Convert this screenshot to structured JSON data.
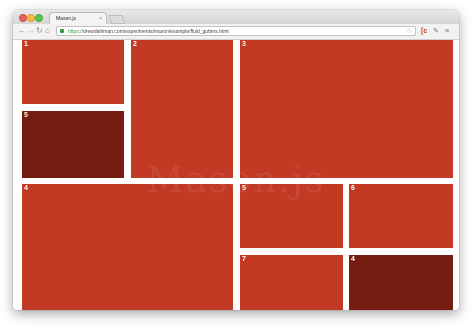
{
  "browser": {
    "tab_title": "Mason.js",
    "tab_close": "×",
    "url_https": "https://",
    "url_rest": "drewdahlman.com/experiments/mason/example/fluid_gutters.html",
    "icons": {
      "back": "←",
      "forward": "→",
      "reload": "↻",
      "home": "⌂",
      "star": "☆",
      "ext1": "[c",
      "ext2": "✎",
      "menu": "≡"
    }
  },
  "page": {
    "watermark": "Mason.js"
  },
  "tiles": [
    {
      "label": "1",
      "shade": "normal"
    },
    {
      "label": "2",
      "shade": "normal"
    },
    {
      "label": "3",
      "shade": "normal"
    },
    {
      "label": "5",
      "shade": "dark"
    },
    {
      "label": "4",
      "shade": "normal"
    },
    {
      "label": "5",
      "shade": "normal"
    },
    {
      "label": "6",
      "shade": "normal"
    },
    {
      "label": "7",
      "shade": "normal"
    },
    {
      "label": "4",
      "shade": "dark"
    }
  ],
  "colors": {
    "tile": "#c23a23",
    "tile_dark": "#761d12",
    "gutter": "#ffffff"
  }
}
